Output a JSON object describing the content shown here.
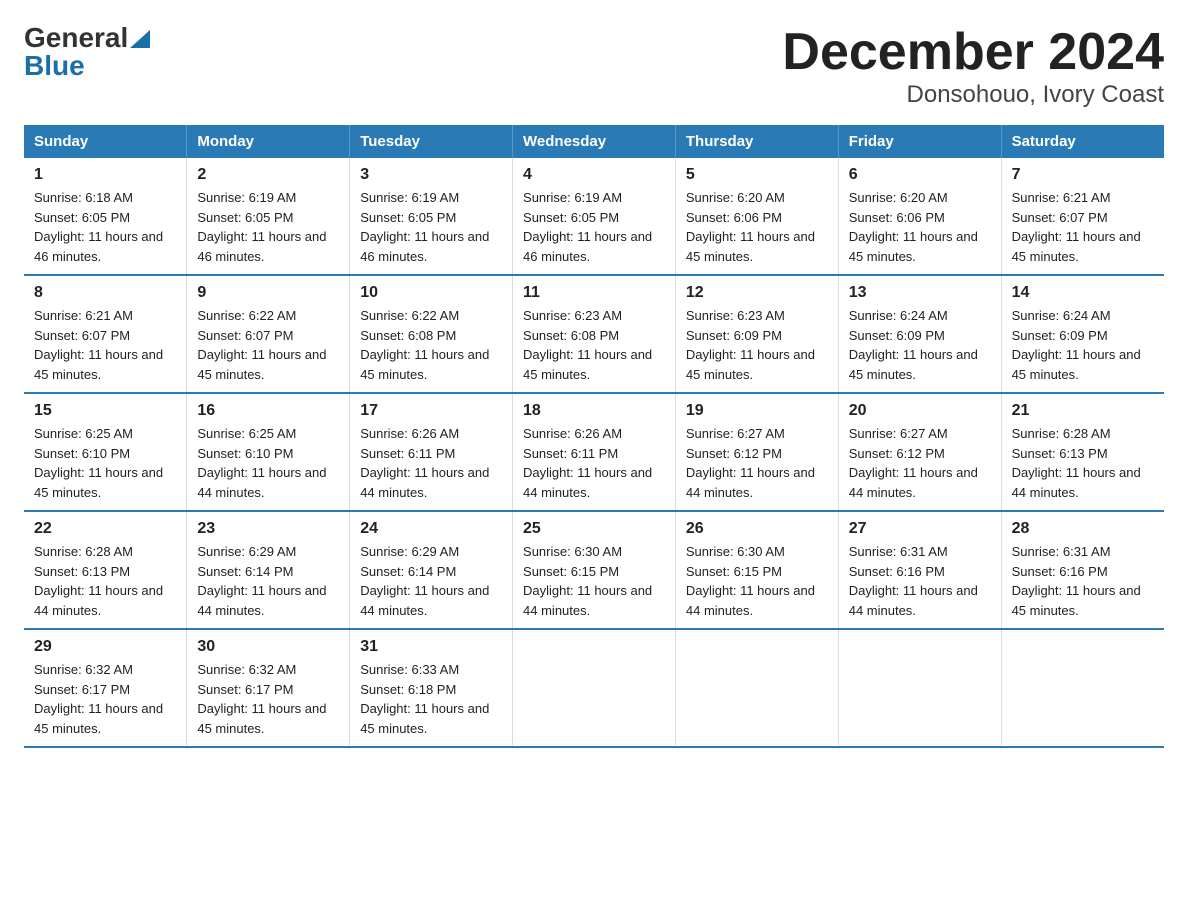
{
  "logo": {
    "general": "General",
    "blue": "Blue"
  },
  "title": "December 2024",
  "subtitle": "Donsohouo, Ivory Coast",
  "days_of_week": [
    "Sunday",
    "Monday",
    "Tuesday",
    "Wednesday",
    "Thursday",
    "Friday",
    "Saturday"
  ],
  "weeks": [
    [
      {
        "day": "1",
        "sunrise": "6:18 AM",
        "sunset": "6:05 PM",
        "daylight": "11 hours and 46 minutes."
      },
      {
        "day": "2",
        "sunrise": "6:19 AM",
        "sunset": "6:05 PM",
        "daylight": "11 hours and 46 minutes."
      },
      {
        "day": "3",
        "sunrise": "6:19 AM",
        "sunset": "6:05 PM",
        "daylight": "11 hours and 46 minutes."
      },
      {
        "day": "4",
        "sunrise": "6:19 AM",
        "sunset": "6:05 PM",
        "daylight": "11 hours and 46 minutes."
      },
      {
        "day": "5",
        "sunrise": "6:20 AM",
        "sunset": "6:06 PM",
        "daylight": "11 hours and 45 minutes."
      },
      {
        "day": "6",
        "sunrise": "6:20 AM",
        "sunset": "6:06 PM",
        "daylight": "11 hours and 45 minutes."
      },
      {
        "day": "7",
        "sunrise": "6:21 AM",
        "sunset": "6:07 PM",
        "daylight": "11 hours and 45 minutes."
      }
    ],
    [
      {
        "day": "8",
        "sunrise": "6:21 AM",
        "sunset": "6:07 PM",
        "daylight": "11 hours and 45 minutes."
      },
      {
        "day": "9",
        "sunrise": "6:22 AM",
        "sunset": "6:07 PM",
        "daylight": "11 hours and 45 minutes."
      },
      {
        "day": "10",
        "sunrise": "6:22 AM",
        "sunset": "6:08 PM",
        "daylight": "11 hours and 45 minutes."
      },
      {
        "day": "11",
        "sunrise": "6:23 AM",
        "sunset": "6:08 PM",
        "daylight": "11 hours and 45 minutes."
      },
      {
        "day": "12",
        "sunrise": "6:23 AM",
        "sunset": "6:09 PM",
        "daylight": "11 hours and 45 minutes."
      },
      {
        "day": "13",
        "sunrise": "6:24 AM",
        "sunset": "6:09 PM",
        "daylight": "11 hours and 45 minutes."
      },
      {
        "day": "14",
        "sunrise": "6:24 AM",
        "sunset": "6:09 PM",
        "daylight": "11 hours and 45 minutes."
      }
    ],
    [
      {
        "day": "15",
        "sunrise": "6:25 AM",
        "sunset": "6:10 PM",
        "daylight": "11 hours and 45 minutes."
      },
      {
        "day": "16",
        "sunrise": "6:25 AM",
        "sunset": "6:10 PM",
        "daylight": "11 hours and 44 minutes."
      },
      {
        "day": "17",
        "sunrise": "6:26 AM",
        "sunset": "6:11 PM",
        "daylight": "11 hours and 44 minutes."
      },
      {
        "day": "18",
        "sunrise": "6:26 AM",
        "sunset": "6:11 PM",
        "daylight": "11 hours and 44 minutes."
      },
      {
        "day": "19",
        "sunrise": "6:27 AM",
        "sunset": "6:12 PM",
        "daylight": "11 hours and 44 minutes."
      },
      {
        "day": "20",
        "sunrise": "6:27 AM",
        "sunset": "6:12 PM",
        "daylight": "11 hours and 44 minutes."
      },
      {
        "day": "21",
        "sunrise": "6:28 AM",
        "sunset": "6:13 PM",
        "daylight": "11 hours and 44 minutes."
      }
    ],
    [
      {
        "day": "22",
        "sunrise": "6:28 AM",
        "sunset": "6:13 PM",
        "daylight": "11 hours and 44 minutes."
      },
      {
        "day": "23",
        "sunrise": "6:29 AM",
        "sunset": "6:14 PM",
        "daylight": "11 hours and 44 minutes."
      },
      {
        "day": "24",
        "sunrise": "6:29 AM",
        "sunset": "6:14 PM",
        "daylight": "11 hours and 44 minutes."
      },
      {
        "day": "25",
        "sunrise": "6:30 AM",
        "sunset": "6:15 PM",
        "daylight": "11 hours and 44 minutes."
      },
      {
        "day": "26",
        "sunrise": "6:30 AM",
        "sunset": "6:15 PM",
        "daylight": "11 hours and 44 minutes."
      },
      {
        "day": "27",
        "sunrise": "6:31 AM",
        "sunset": "6:16 PM",
        "daylight": "11 hours and 44 minutes."
      },
      {
        "day": "28",
        "sunrise": "6:31 AM",
        "sunset": "6:16 PM",
        "daylight": "11 hours and 45 minutes."
      }
    ],
    [
      {
        "day": "29",
        "sunrise": "6:32 AM",
        "sunset": "6:17 PM",
        "daylight": "11 hours and 45 minutes."
      },
      {
        "day": "30",
        "sunrise": "6:32 AM",
        "sunset": "6:17 PM",
        "daylight": "11 hours and 45 minutes."
      },
      {
        "day": "31",
        "sunrise": "6:33 AM",
        "sunset": "6:18 PM",
        "daylight": "11 hours and 45 minutes."
      },
      null,
      null,
      null,
      null
    ]
  ]
}
